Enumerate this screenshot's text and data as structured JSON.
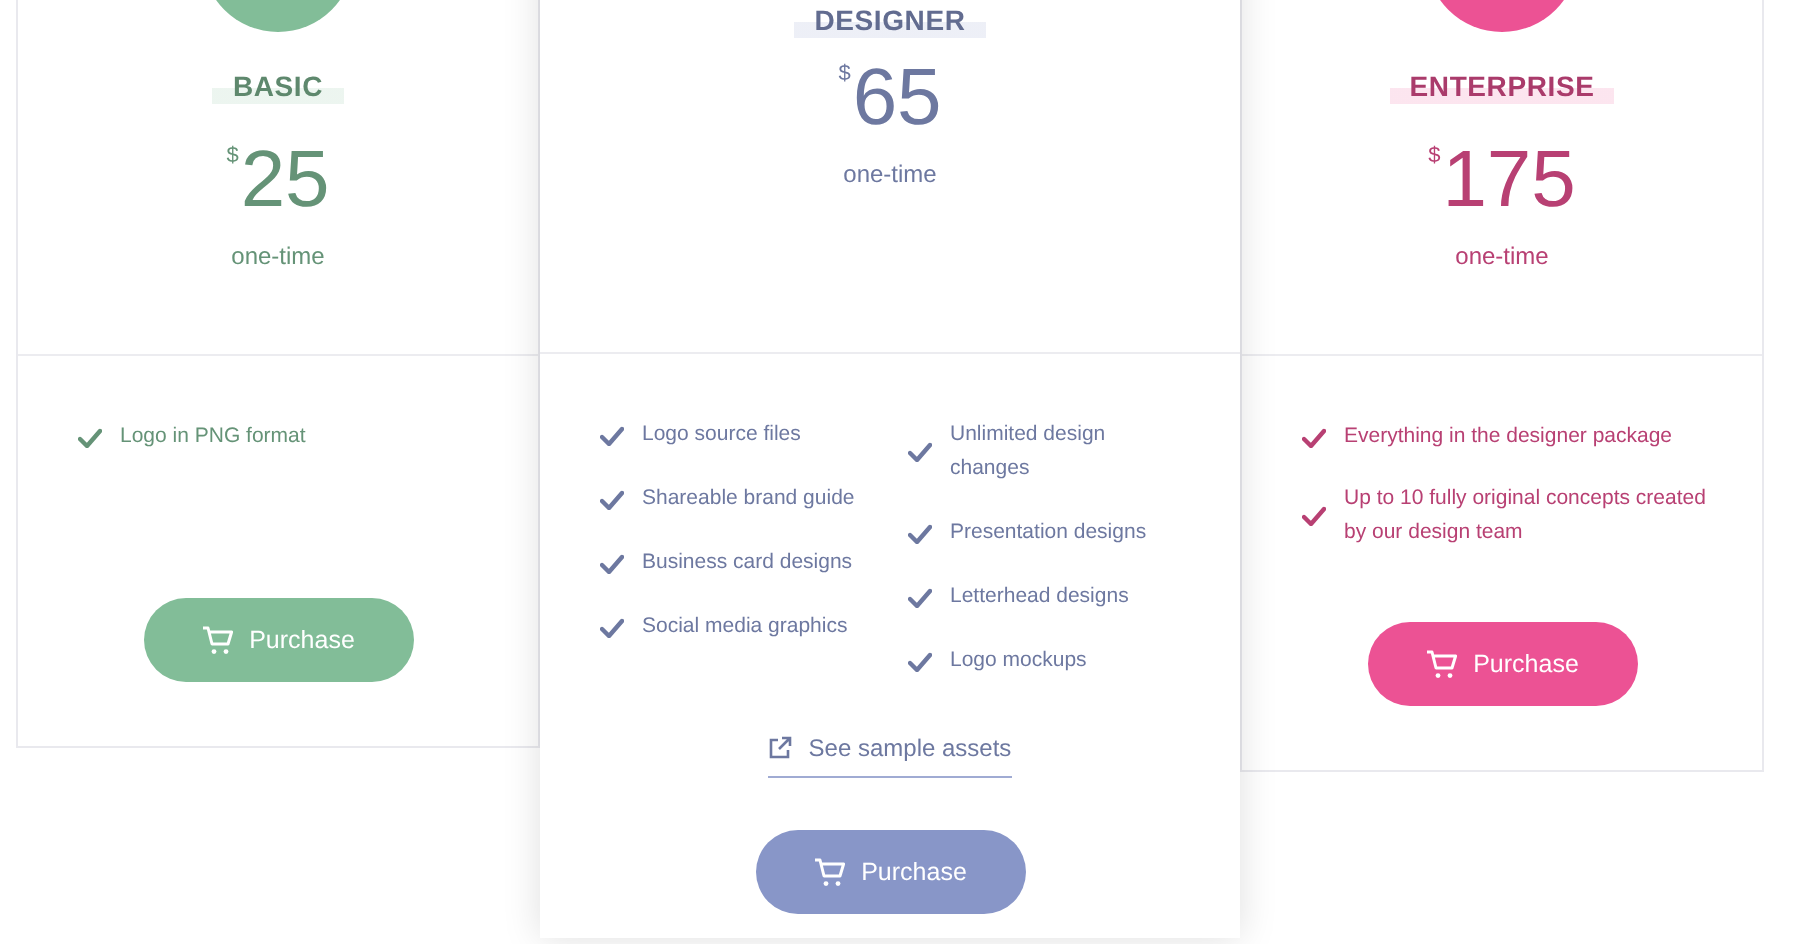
{
  "plans": [
    {
      "name": "BASIC",
      "currency": "$",
      "price": "25",
      "period": "one-time",
      "color": "#82bd98",
      "featured": false,
      "feature_columns": [
        [
          "Logo in PNG format"
        ]
      ],
      "button": "Purchase"
    },
    {
      "name": "DESIGNER",
      "currency": "$",
      "price": "65",
      "period": "one-time",
      "color": "#8896c8",
      "featured": true,
      "feature_columns": [
        [
          "Logo source files",
          "Shareable brand guide",
          "Business card designs",
          "Social media graphics"
        ],
        [
          "Unlimited design changes",
          "Presentation designs",
          "Letterhead designs",
          "Logo mockups"
        ]
      ],
      "link": "See sample assets",
      "button": "Purchase"
    },
    {
      "name": "ENTERPRISE",
      "currency": "$",
      "price": "175",
      "period": "one-time",
      "color": "#ec5294",
      "featured": false,
      "feature_columns": [
        [
          "Everything in the designer package",
          "Up to 10 fully original concepts created by our design team"
        ]
      ],
      "button": "Purchase"
    }
  ]
}
